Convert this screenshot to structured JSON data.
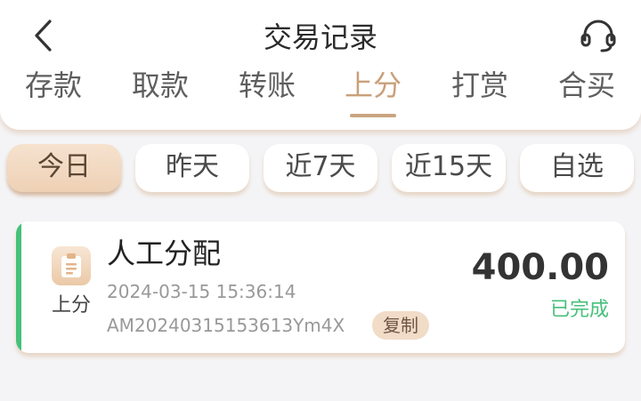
{
  "header": {
    "title": "交易记录",
    "back_icon": "chevron-left-icon",
    "service_icon": "headset-icon"
  },
  "tabs": [
    {
      "label": "存款",
      "active": false
    },
    {
      "label": "取款",
      "active": false
    },
    {
      "label": "转账",
      "active": false
    },
    {
      "label": "上分",
      "active": true
    },
    {
      "label": "打赏",
      "active": false
    },
    {
      "label": "合买",
      "active": false
    }
  ],
  "filters": [
    {
      "label": "今日",
      "active": true
    },
    {
      "label": "昨天",
      "active": false
    },
    {
      "label": "近7天",
      "active": false
    },
    {
      "label": "近15天",
      "active": false
    },
    {
      "label": "自选",
      "active": false
    }
  ],
  "record": {
    "type_label": "上分",
    "type_icon": "clipboard-icon",
    "description": "人工分配",
    "datetime": "2024-03-15 15:36:14",
    "order_no": "AM20240315153613Ym4X",
    "copy_label": "复制",
    "amount": "400.00",
    "status": "已完成"
  },
  "colors": {
    "accent": "#c9a07a",
    "success": "#46c07a",
    "chip_active_bg": "#f1d8c1",
    "background": "#f4f4f6"
  }
}
